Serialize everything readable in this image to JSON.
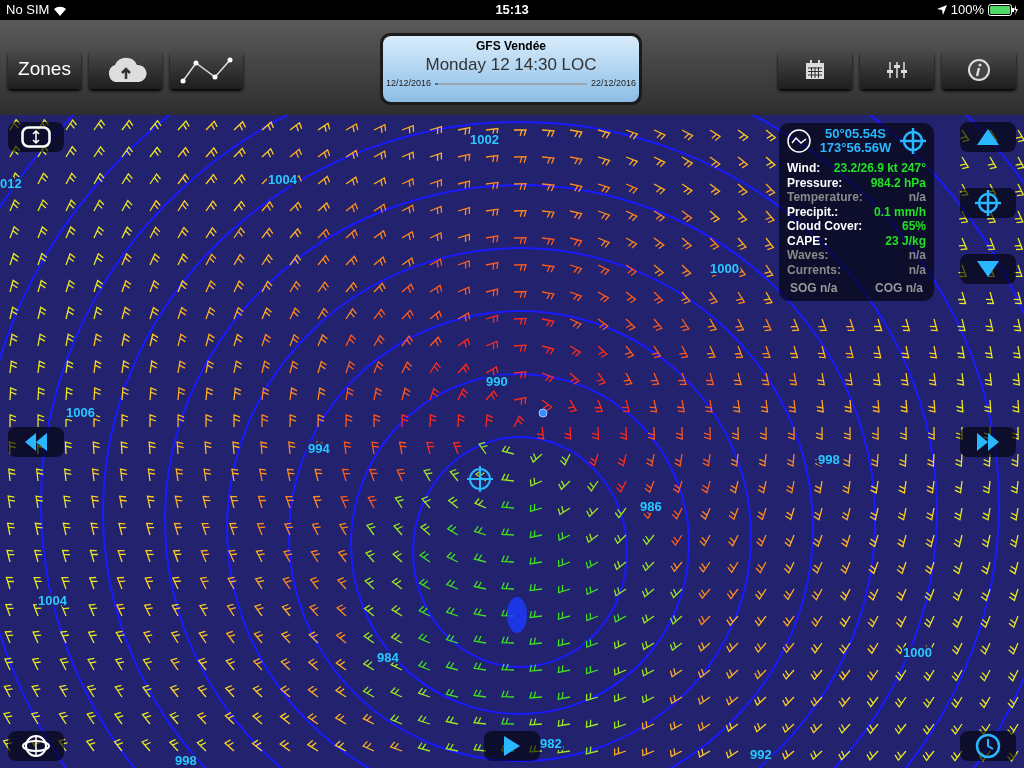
{
  "status_bar": {
    "carrier": "No SIM",
    "time": "15:13",
    "battery": "100%"
  },
  "toolbar": {
    "zones_button": "Zones"
  },
  "model_panel": {
    "title": "GFS Vendée",
    "datetime": "Monday 12 14:30 LOC",
    "start_date": "12/12/2016",
    "end_date": "22/12/2016",
    "level": 0.02
  },
  "info_panel": {
    "latitude": "50°05.54S",
    "longitude": "173°56.56W",
    "rows": [
      {
        "label": "Wind:",
        "value": "23.2/26.9 kt 247°",
        "available": true
      },
      {
        "label": "Pressure:",
        "value": "984.2 hPa",
        "available": true
      },
      {
        "label": "Temperature:",
        "value": "n/a",
        "available": false
      },
      {
        "label": "Precipit.:",
        "value": "0.1 mm/h",
        "available": true
      },
      {
        "label": "Cloud Cover:",
        "value": "65%",
        "available": true
      },
      {
        "label": "CAPE :",
        "value": "23 J/kg",
        "available": true
      },
      {
        "label": "Waves:",
        "value": "n/a",
        "available": false
      },
      {
        "label": "Currents:",
        "value": "n/a",
        "available": false
      }
    ],
    "sog": "SOG n/a",
    "cog": "COG n/a"
  },
  "isobar_labels": [
    "1002",
    "012",
    "1004",
    "1000",
    "990",
    "1006",
    "994",
    "998",
    "986",
    "1004",
    "984",
    "1000",
    "998",
    "982",
    "992"
  ]
}
